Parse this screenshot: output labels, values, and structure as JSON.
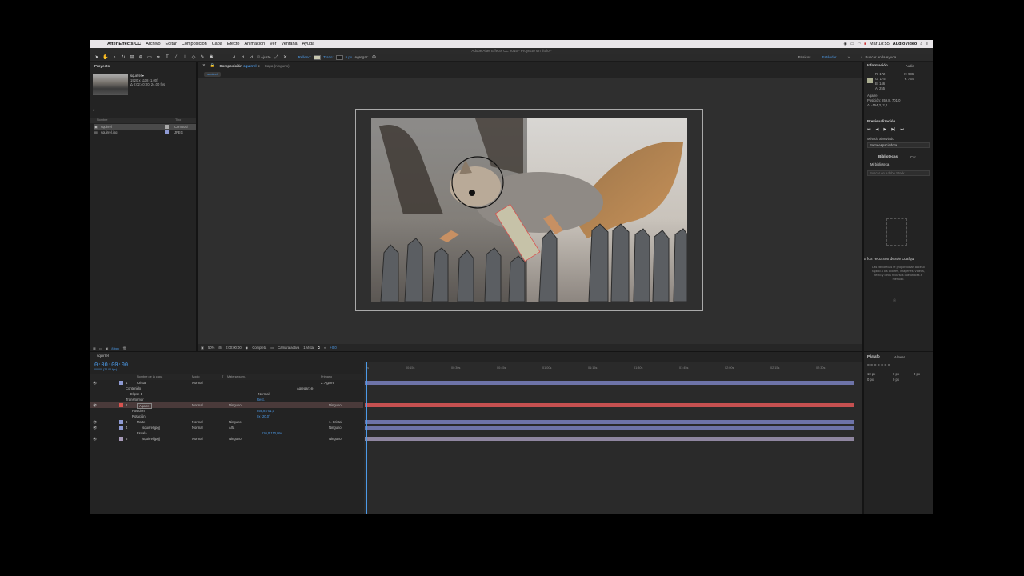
{
  "macbar": {
    "app_name": "After Effects CC",
    "menus": [
      "Archivo",
      "Editar",
      "Composición",
      "Capa",
      "Efecto",
      "Animación",
      "Ver",
      "Ventana",
      "Ayuda"
    ],
    "clock": "Mar 18:55",
    "user": "AudioVideo"
  },
  "window_title": "Adobe After Effects CC 2015 - Proyecto sin título *",
  "toolbar": {
    "ajuste": "Ajuste",
    "relleno": "Relleno:",
    "trazo": "Trazo:",
    "stroke_px": "5 px",
    "agregar": "Agregar:",
    "workspaces": [
      "Básicos",
      "Estándar"
    ],
    "search_help": "Buscar en la Ayuda"
  },
  "project": {
    "tab": "Proyecto",
    "item_name": "squirrel ▾",
    "item_dims": "1920 x 1118 (1,00)",
    "item_dur": "Δ 0:02:40:00, 24,00 fps",
    "col_name": "Nombre",
    "col_type": "Tipo",
    "items": [
      {
        "name": "squirrel",
        "type": "Composi"
      },
      {
        "name": "squirrel.jpg",
        "type": "JPEG"
      }
    ],
    "bpc": "8 bpc"
  },
  "comp": {
    "tab_prefix": "Composición",
    "tab_name": "squirrel",
    "tab_layer": "Capa (ninguno)",
    "breadcrumb": "squirrel",
    "zoom": "50%",
    "time": "0:00:00:00",
    "resolution": "Completa",
    "camera": "Cámara activa",
    "views": "1 Vista",
    "exposure": "+0,0"
  },
  "info": {
    "tab_info": "Información",
    "tab_audio": "Audio",
    "r": "R:  172",
    "g": "G:  175",
    "b": "B:  146",
    "a": "A:  255",
    "x": "X:  986",
    "y": "Y:  764",
    "layer": "Agarre",
    "pos": "Posición: 859,8, 701,0",
    "delta": "Δ: -154,3, 2,0",
    "color_sample": "#acaf92"
  },
  "preview": {
    "title": "Previsualización",
    "method_label": "Método abreviado",
    "method_value": "Barra espaciadora"
  },
  "libraries": {
    "tab": "Bibliotecas",
    "tab2": "Car.",
    "library": "Mi biblioteca",
    "search": "Buscar en Adobe Stock",
    "headline": "a los recursos desde cualqu",
    "body": "Las bibliotecas te proporcionan acceso rápido a los colores, imágenes, vídeos, texto y otros recursos que utilices a menudo."
  },
  "paragraph": {
    "tab": "Párrafo",
    "tab2": "Alinear",
    "values": [
      "10 px",
      "0 px",
      "0 px",
      "0 px",
      "0 px"
    ]
  },
  "timeline": {
    "tab": "squirrel",
    "timecode": "0:00:00:00",
    "frames": "00000 (24.00 fps)",
    "headers": {
      "name": "Nombre de la capa",
      "mode": "Modo",
      "t": "T",
      "matte": "Mate seguim.",
      "parent": "Primario"
    },
    "layers": [
      {
        "num": "1",
        "name": "Cristal",
        "mode": "Normal",
        "matte": "",
        "parent": "2. Agarre",
        "color": "#8e9ad3"
      },
      {
        "num": "",
        "name": "Contenido",
        "mode": "",
        "matte": "",
        "parent": "Agregar: ⊕",
        "color": ""
      },
      {
        "num": "",
        "name": "Elipse 1",
        "mode": "Normal",
        "matte": "",
        "parent": "",
        "color": ""
      },
      {
        "num": "",
        "name": "Transformar",
        "mode": "",
        "matte": "Rest.",
        "parent": "",
        "color": ""
      },
      {
        "num": "2",
        "name": "Agarre",
        "mode": "Normal",
        "matte": "Ninguno",
        "parent": "Ninguno",
        "color": "#d9534f"
      },
      {
        "num": "",
        "name": "Posición",
        "mode": "",
        "matte": "859,8,701,0",
        "parent": "",
        "color": ""
      },
      {
        "num": "",
        "name": "Rotación",
        "mode": "",
        "matte": "0x -20,0°",
        "parent": "",
        "color": ""
      },
      {
        "num": "3",
        "name": "Matte",
        "mode": "Normal",
        "matte": "Ninguno",
        "parent": "1. Cristal",
        "color": "#8e9ad3"
      },
      {
        "num": "4",
        "name": "[squirrel.jpg]",
        "mode": "Normal",
        "matte": "Alfa",
        "parent": "Ninguno",
        "color": "#8e9ad3"
      },
      {
        "num": "",
        "name": "Escala",
        "mode": "",
        "matte": "110,0,110,0%",
        "parent": "",
        "color": ""
      },
      {
        "num": "5",
        "name": "[squirrel.jpg]",
        "mode": "Normal",
        "matte": "Ninguno",
        "parent": "Ninguno",
        "color": "#a79ab8"
      }
    ],
    "ruler": [
      "0s",
      "00:15s",
      "00:30s",
      "00:45s",
      "01:00s",
      "01:15s",
      "01:30s",
      "01:45s",
      "02:00s",
      "02:15s",
      "02:30s"
    ]
  }
}
